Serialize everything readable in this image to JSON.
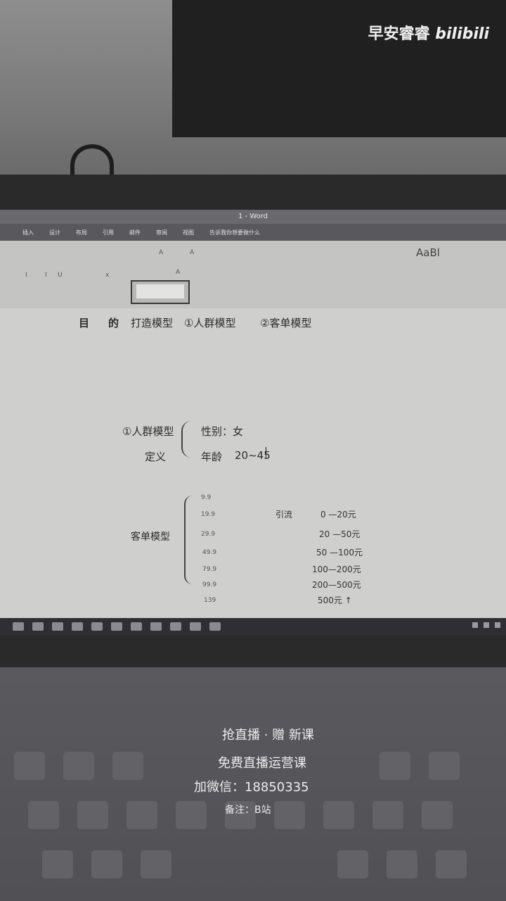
{
  "watermark": {
    "channel": "早安睿睿",
    "logo": "bilibili"
  },
  "window": {
    "title": "1 - Word"
  },
  "ribbon": {
    "tabs": [
      "插入",
      "设计",
      "布局",
      "引用",
      "邮件",
      "审阅",
      "视图",
      "告诉我你想要做什么"
    ],
    "style_preview": "AaBl"
  },
  "document": {
    "purpose_line": {
      "label1": "目",
      "label2": "的",
      "item1": "打造模型",
      "item2": "①人群模型",
      "item3": "②客单模型"
    },
    "crowd": {
      "title": "①人群模型",
      "subtitle": "定义",
      "gender": "性别：女",
      "age_label": "年龄",
      "age_value": "20~45"
    },
    "price": {
      "title": "客单模型",
      "left_values": [
        "9.9",
        "19.9",
        "29.9",
        "49.9",
        "79.9",
        "99.9",
        "139"
      ],
      "mid_label": "引流",
      "ranges": [
        "0 —20元",
        "20 —50元",
        "50 —100元",
        "100—200元",
        "200—500元",
        "500元 ↑"
      ]
    }
  },
  "keyboard_overlay": {
    "line1": "抢直播 · 赠 新课",
    "line2": "免费直播运营课",
    "line3": "加微信：18850335",
    "line4": "备注：B站"
  }
}
